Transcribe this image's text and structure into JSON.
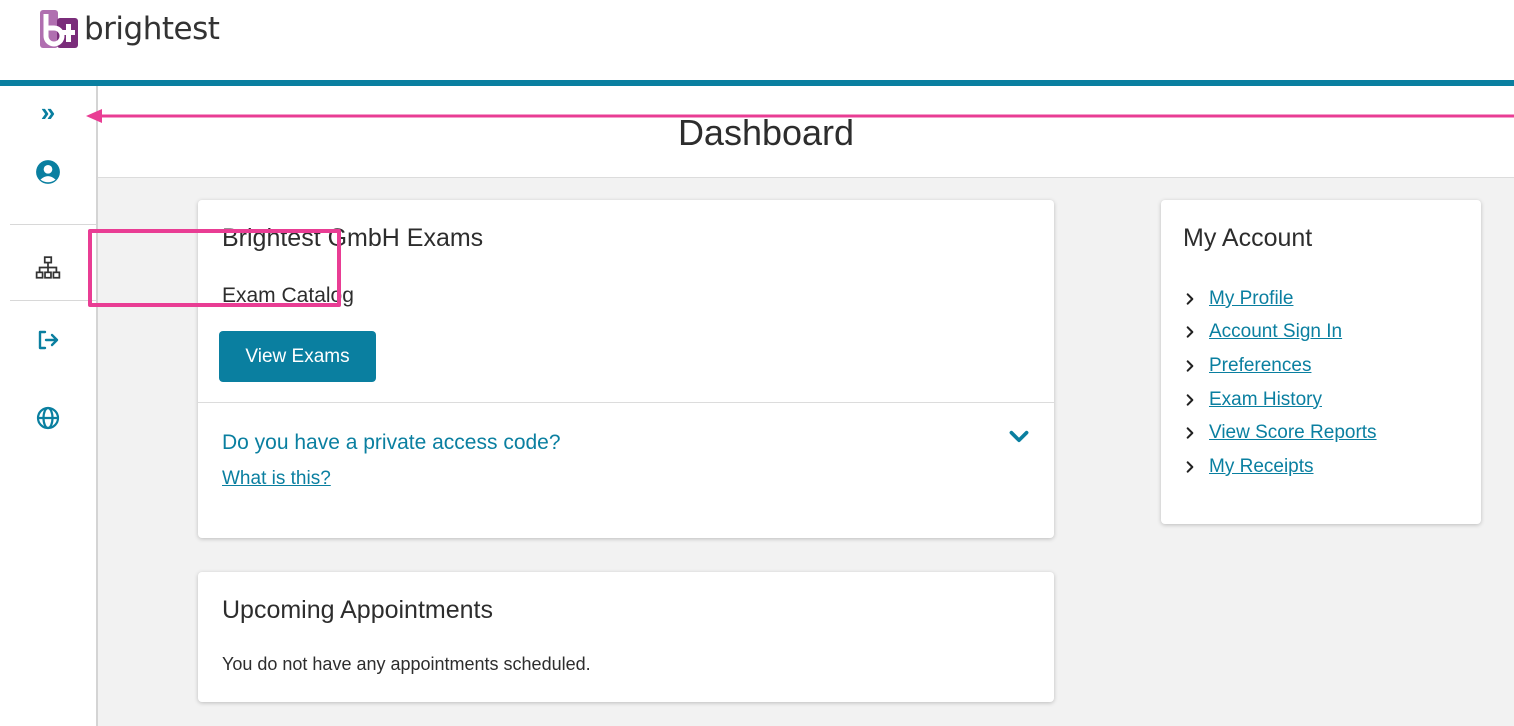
{
  "brand": {
    "name": "brightest",
    "colors": {
      "accent": "#0a7fa0",
      "mark_left": "#b06fb0",
      "mark_right": "#7a2d7a",
      "annotation": "#e93d94"
    }
  },
  "sidebar": {
    "items": [
      {
        "icon": "chevrons-right-icon",
        "label": "»"
      },
      {
        "icon": "user-circle-icon"
      },
      {
        "icon": "sitemap-icon"
      },
      {
        "icon": "sign-out-icon"
      },
      {
        "icon": "globe-icon"
      }
    ]
  },
  "page": {
    "title": "Dashboard"
  },
  "exams_card": {
    "title": "Brightest GmbH Exams",
    "catalog_label": "Exam Catalog",
    "view_button": "View Exams",
    "access_question": "Do you have a private access code?",
    "what_link": "What is this?"
  },
  "appointments_card": {
    "title": "Upcoming Appointments",
    "empty_text": "You do not have any appointments scheduled."
  },
  "account_card": {
    "title": "My Account",
    "links": [
      "My Profile",
      "Account Sign In",
      "Preferences",
      "Exam History",
      "View Score Reports",
      "My Receipts"
    ]
  }
}
